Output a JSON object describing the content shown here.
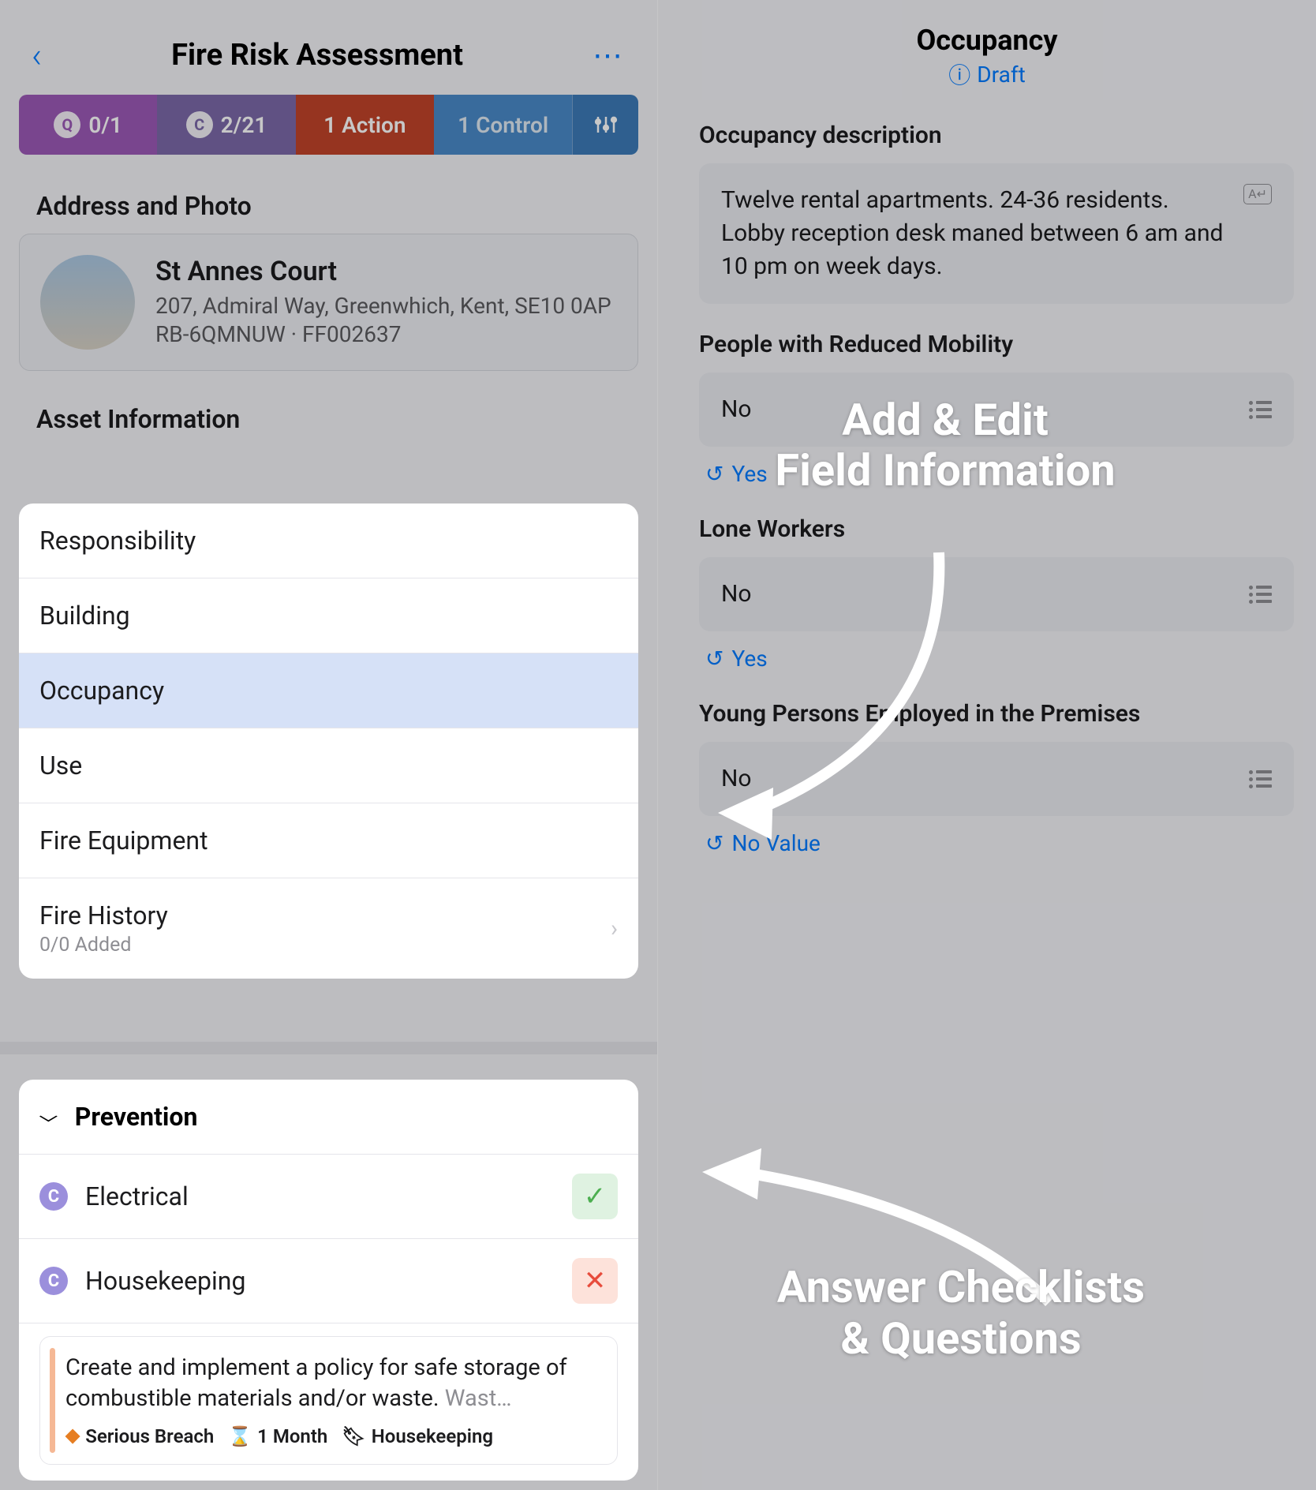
{
  "left": {
    "title": "Fire Risk Assessment",
    "pills": {
      "q": "0/1",
      "c": "2/21",
      "action": "1 Action",
      "control": "1 Control"
    },
    "address_section": "Address and Photo",
    "address": {
      "name": "St Annes Court",
      "line1": "207, Admiral Way, Greenwhich, Kent, SE10 0AP",
      "line2": "RB-6QMNUW · FF002637"
    },
    "asset_section": "Asset Information",
    "asset_items": {
      "responsibility": "Responsibility",
      "building": "Building",
      "occupancy": "Occupancy",
      "use": "Use",
      "fire_equipment": "Fire Equipment",
      "fire_history": "Fire History",
      "fire_history_sub": "0/0 Added"
    },
    "prevention": {
      "title": "Prevention",
      "electrical": "Electrical",
      "housekeeping": "Housekeeping",
      "finding_text": "Create and implement a policy for safe storage of combustible materials and/or waste. ",
      "finding_trunc": "Wast…",
      "severity": "Serious Breach",
      "period": "1 Month",
      "tag": "Housekeeping"
    }
  },
  "right": {
    "title": "Occupancy",
    "status": "Draft",
    "fields": {
      "desc_label": "Occupancy description",
      "desc_value": "Twelve rental apartments. 24-36 residents. Lobby reception desk maned between 6 am and 10 pm on week days.",
      "prm_label": "People with Reduced Mobility",
      "prm_value": "No",
      "prm_prev": "Yes",
      "lone_label": "Lone Workers",
      "lone_value": "No",
      "lone_prev": "Yes",
      "young_label": "Young Persons Employed in the Premises",
      "young_value": "No",
      "young_prev": "No Value"
    }
  },
  "callouts": {
    "c1a": "Add & Edit",
    "c1b": "Field Information",
    "c2a": "Answer Checklists",
    "c2b": "& Questions"
  }
}
